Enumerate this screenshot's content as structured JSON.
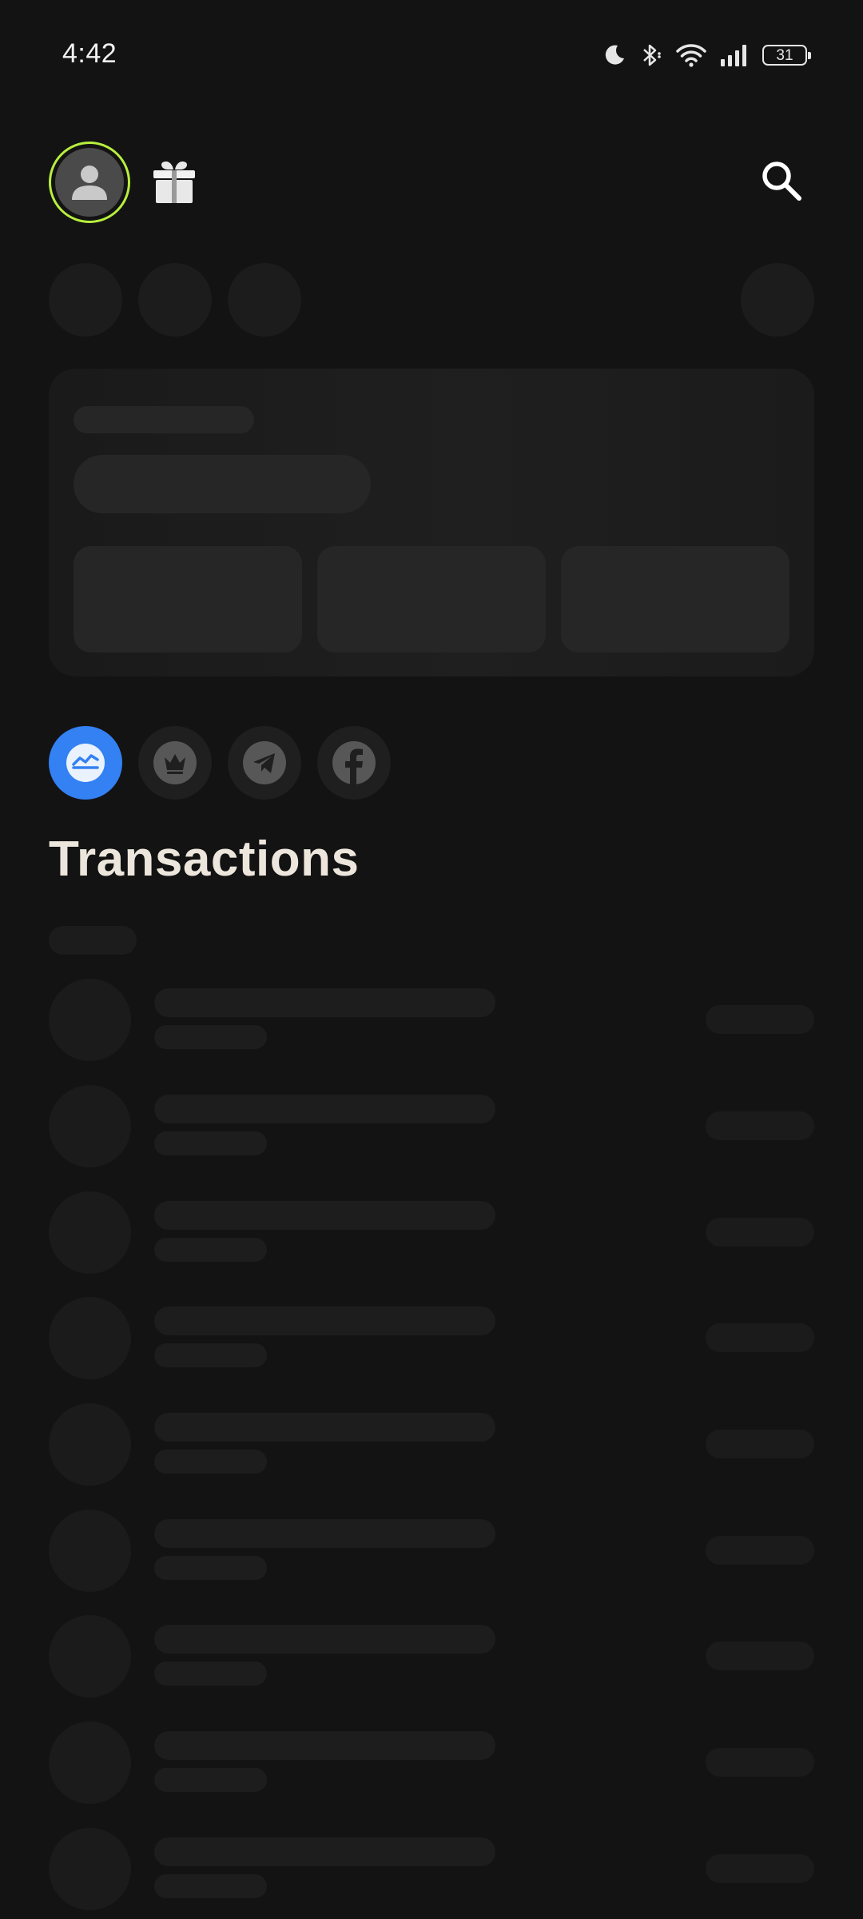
{
  "status_bar": {
    "time": "4:42",
    "battery_level": "31",
    "icons": [
      "moon-icon",
      "bluetooth-icon",
      "wifi-icon",
      "cellular-signal-icon",
      "battery-icon"
    ]
  },
  "header": {
    "avatar_icon": "person-icon",
    "avatar_ring_color": "#b8ef3e",
    "gift_icon": "gift-icon",
    "search_icon": "search-icon"
  },
  "filters": [
    {
      "icon": "chart-line-icon",
      "active": true,
      "color": "#3381f2"
    },
    {
      "icon": "crown-icon",
      "active": false
    },
    {
      "icon": "telegram-icon",
      "active": false
    },
    {
      "icon": "facebook-icon",
      "active": false
    }
  ],
  "transactions": {
    "title": "Transactions",
    "placeholder_rows": 9
  },
  "colors": {
    "background": "#131313",
    "skeleton": "#1c1c1c",
    "accent": "#3381f2",
    "title_text": "#ece6dc"
  }
}
